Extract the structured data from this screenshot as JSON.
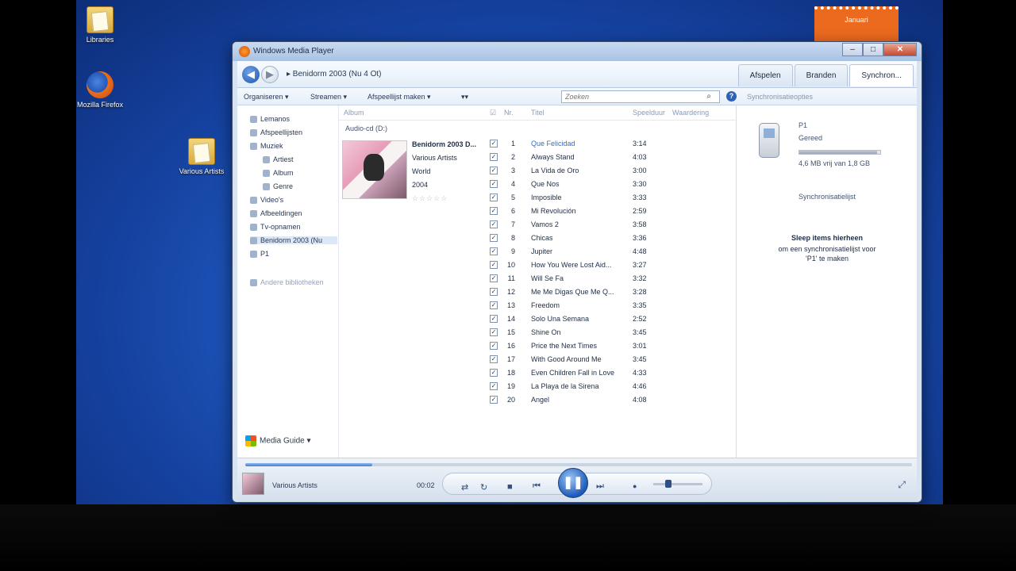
{
  "desktop": {
    "icons": [
      {
        "label": "Libraries"
      },
      {
        "label": "Mozilla Firefox"
      },
      {
        "label": "Various Artists"
      }
    ],
    "calendar_month": "Januari"
  },
  "window": {
    "title": "Windows Media Player",
    "close_glyph": "✕",
    "max_glyph": "□",
    "min_glyph": "–"
  },
  "nav": {
    "back_glyph": "◀",
    "forward_glyph": "▶",
    "breadcrumb": "▸  Benidorm 2003 (Nu 4 Ot)",
    "tabs": [
      "Afspelen",
      "Branden",
      "Synchron..."
    ]
  },
  "toolbar": {
    "organize": "Organiseren ▾",
    "stream": "Streamen ▾",
    "create_playlist": "Afspeellijst maken ▾",
    "more": "▾▾",
    "search_placeholder": "Zoeken",
    "sync_options": "Synchronisatieopties"
  },
  "navpane": {
    "items": [
      {
        "label": "Lemanos"
      },
      {
        "label": "Afspeellijsten"
      },
      {
        "label": "Muziek"
      },
      {
        "label": "Artiest"
      },
      {
        "label": "Album"
      },
      {
        "label": "Genre"
      },
      {
        "label": "Video's"
      },
      {
        "label": "Afbeeldingen"
      },
      {
        "label": "Tv-opnamen"
      },
      {
        "label": "Benidorm 2003 (Nu"
      },
      {
        "label": "P1"
      },
      {
        "label": "Andere bibliotheken"
      }
    ],
    "media_guide": "Media Guide ▾"
  },
  "list": {
    "columns": {
      "album": "Album",
      "num": "Nr.",
      "title": "Titel",
      "length": "Speelduur",
      "rating": "Waardering"
    },
    "group_label": "Audio-cd (D:)",
    "album_title": "Benidorm 2003 D...",
    "album_artist": "Various Artists",
    "album_genre": "World",
    "album_year": "2004",
    "stars": "☆☆☆☆☆",
    "tracks": [
      {
        "num": "1",
        "title": "Que Felicidad",
        "length": "3:14"
      },
      {
        "num": "2",
        "title": "Always Stand",
        "length": "4:03"
      },
      {
        "num": "3",
        "title": "La Vida de Oro",
        "length": "3:00"
      },
      {
        "num": "4",
        "title": "Que Nos",
        "length": "3:30"
      },
      {
        "num": "5",
        "title": "Imposible",
        "length": "3:33"
      },
      {
        "num": "6",
        "title": "Mi Revolución",
        "length": "2:59"
      },
      {
        "num": "7",
        "title": "Vamos 2",
        "length": "3:58"
      },
      {
        "num": "8",
        "title": "Chicas",
        "length": "3:36"
      },
      {
        "num": "9",
        "title": "Jupiter",
        "length": "4:48"
      },
      {
        "num": "10",
        "title": "How You Were Lost Aid...",
        "length": "3:27"
      },
      {
        "num": "11",
        "title": "Will Se Fa",
        "length": "3:32"
      },
      {
        "num": "12",
        "title": "Me Me Digas Que Me Q...",
        "length": "3:28"
      },
      {
        "num": "13",
        "title": "Freedom",
        "length": "3:35"
      },
      {
        "num": "14",
        "title": "Solo Una Semana",
        "length": "2:52"
      },
      {
        "num": "15",
        "title": "Shine On",
        "length": "3:45"
      },
      {
        "num": "16",
        "title": "Price the Next Times",
        "length": "3:01"
      },
      {
        "num": "17",
        "title": "With Good Around Me",
        "length": "3:45"
      },
      {
        "num": "18",
        "title": "Even Children Fall in Love",
        "length": "4:33"
      },
      {
        "num": "19",
        "title": "La Playa de la Sirena",
        "length": "4:46"
      },
      {
        "num": "20",
        "title": "Angel",
        "length": "4:08"
      }
    ],
    "check_glyph": "✓"
  },
  "sync": {
    "device_name": "P1",
    "device_status": "Gereed",
    "capacity_text": "4,6 MB vrij van 1,8 GB",
    "capacity_used_fraction": 0.96,
    "sync_list_label": "Synchronisatielijst",
    "drag_title": "Sleep items hierheen",
    "drag_sub1": "om een synchronisatielijst voor",
    "drag_sub2": "'P1' te maken"
  },
  "player": {
    "now_playing_artist": "Various Artists",
    "time": "00:02",
    "shuffle_glyph": "⇄",
    "repeat_glyph": "↻",
    "stop_glyph": "■",
    "prev_glyph": "⏮",
    "pause_glyph": "❚❚",
    "next_glyph": "⏭",
    "mute_glyph": "●",
    "fullscreen_glyph": "⤢",
    "seek_fraction": 0.19,
    "volume_fraction": 0.25
  }
}
